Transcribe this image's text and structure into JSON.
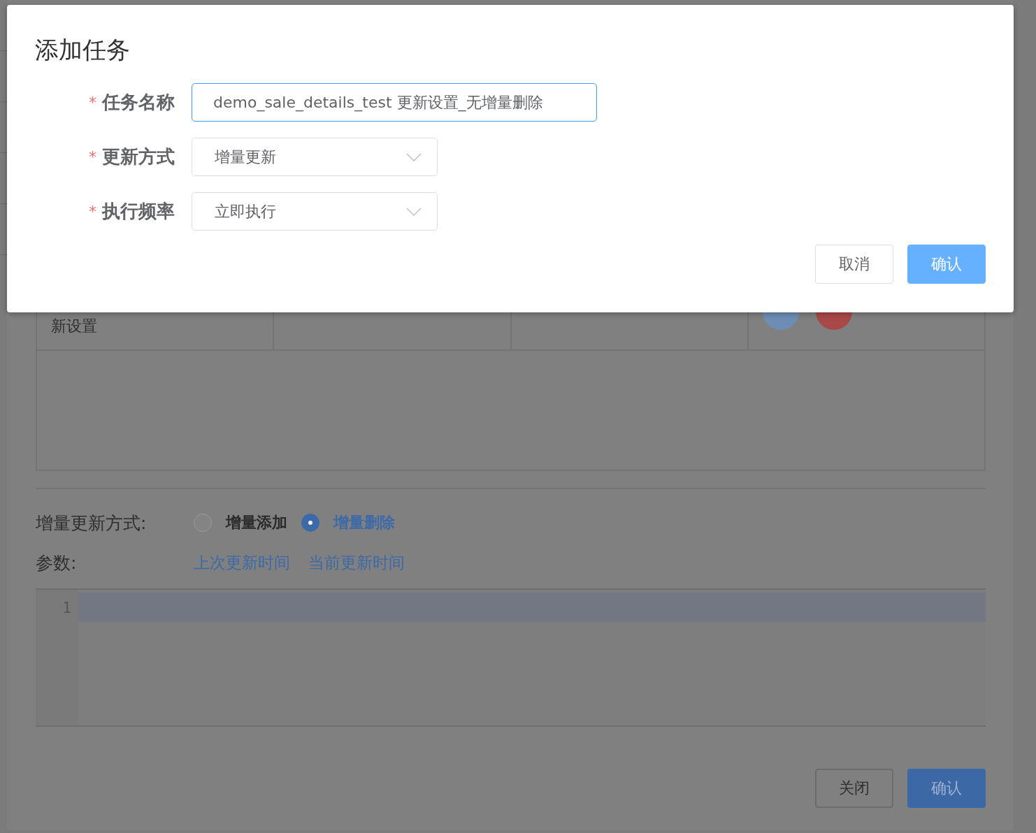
{
  "background_dialog": {
    "table_row": {
      "cell_1": "新设置",
      "actions": [
        {
          "kind": "edit"
        },
        {
          "kind": "delete"
        }
      ]
    },
    "increment_mode": {
      "label": "增量更新方式:",
      "options": [
        {
          "label": "增量添加",
          "selected": false
        },
        {
          "label": "增量删除",
          "selected": true
        }
      ]
    },
    "params": {
      "label": "参数:",
      "links": [
        "上次更新时间",
        "当前更新时间"
      ]
    },
    "editor": {
      "line_numbers": [
        "1"
      ]
    },
    "buttons": [
      {
        "label": "关闭",
        "kind": "default"
      },
      {
        "label": "确认",
        "kind": "primary"
      }
    ]
  },
  "modal": {
    "title": "添加任务",
    "fields": [
      {
        "label": "任务名称",
        "required_mark": "*",
        "kind": "input",
        "value": "demo_sale_details_test 更新设置_无增量删除",
        "focused": true
      },
      {
        "label": "更新方式",
        "required_mark": "*",
        "kind": "select",
        "value": "增量更新",
        "focused": false
      },
      {
        "label": "执行频率",
        "required_mark": "*",
        "kind": "select",
        "value": "立即执行",
        "focused": false
      }
    ],
    "buttons": [
      {
        "label": "取消",
        "kind": "default"
      },
      {
        "label": "确认",
        "kind": "primary"
      }
    ]
  }
}
